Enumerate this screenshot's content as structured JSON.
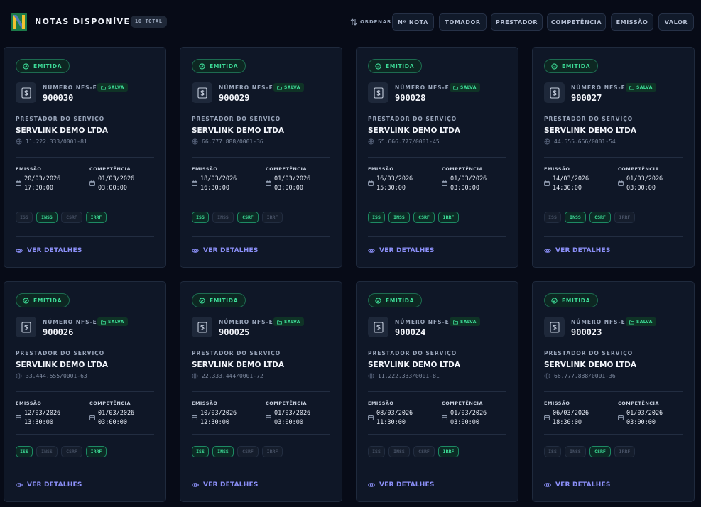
{
  "header": {
    "title": "NOTAS DISPONÍVEIS",
    "total_badge": "10 TOTAL",
    "order_label": "ORDENAR",
    "sort_buttons": [
      "Nº NOTA",
      "TOMADOR",
      "PRESTADOR",
      "COMPETÊNCIA",
      "EMISSÃO",
      "VALOR"
    ]
  },
  "labels": {
    "status": "EMITIDA",
    "numero": "NÚMERO NFS-E",
    "salva": "SALVA",
    "prestador": "PRESTADOR DO SERVIÇO",
    "emissao": "EMISSÃO",
    "competencia": "COMPETÊNCIA",
    "ver_detalhes": "VER DETALHES"
  },
  "tax_names": [
    "ISS",
    "INSS",
    "CSRF",
    "IRRF"
  ],
  "cards": [
    {
      "numero": "900030",
      "prestador": "SERVLINK DEMO LTDA",
      "cnpj": "11.222.333/0001-81",
      "emissao_date": "20/03/2026",
      "emissao_time": "17:30:00",
      "competencia_date": "01/03/2026",
      "competencia_time": "03:00:00",
      "taxes": [
        false,
        true,
        false,
        true
      ]
    },
    {
      "numero": "900029",
      "prestador": "SERVLINK DEMO LTDA",
      "cnpj": "66.777.888/0001-36",
      "emissao_date": "18/03/2026",
      "emissao_time": "16:30:00",
      "competencia_date": "01/03/2026",
      "competencia_time": "03:00:00",
      "taxes": [
        true,
        false,
        true,
        false
      ]
    },
    {
      "numero": "900028",
      "prestador": "SERVLINK DEMO LTDA",
      "cnpj": "55.666.777/0001-45",
      "emissao_date": "16/03/2026",
      "emissao_time": "15:30:00",
      "competencia_date": "01/03/2026",
      "competencia_time": "03:00:00",
      "taxes": [
        true,
        true,
        true,
        true
      ]
    },
    {
      "numero": "900027",
      "prestador": "SERVLINK DEMO LTDA",
      "cnpj": "44.555.666/0001-54",
      "emissao_date": "14/03/2026",
      "emissao_time": "14:30:00",
      "competencia_date": "01/03/2026",
      "competencia_time": "03:00:00",
      "taxes": [
        false,
        true,
        true,
        false
      ]
    },
    {
      "numero": "900026",
      "prestador": "SERVLINK DEMO LTDA",
      "cnpj": "33.444.555/0001-63",
      "emissao_date": "12/03/2026",
      "emissao_time": "13:30:00",
      "competencia_date": "01/03/2026",
      "competencia_time": "03:00:00",
      "taxes": [
        true,
        false,
        false,
        true
      ]
    },
    {
      "numero": "900025",
      "prestador": "SERVLINK DEMO LTDA",
      "cnpj": "22.333.444/0001-72",
      "emissao_date": "10/03/2026",
      "emissao_time": "12:30:00",
      "competencia_date": "01/03/2026",
      "competencia_time": "03:00:00",
      "taxes": [
        true,
        true,
        false,
        false
      ]
    },
    {
      "numero": "900024",
      "prestador": "SERVLINK DEMO LTDA",
      "cnpj": "11.222.333/0001-81",
      "emissao_date": "08/03/2026",
      "emissao_time": "11:30:00",
      "competencia_date": "01/03/2026",
      "competencia_time": "03:00:00",
      "taxes": [
        false,
        false,
        false,
        true
      ]
    },
    {
      "numero": "900023",
      "prestador": "SERVLINK DEMO LTDA",
      "cnpj": "66.777.888/0001-36",
      "emissao_date": "06/03/2026",
      "emissao_time": "18:30:00",
      "competencia_date": "01/03/2026",
      "competencia_time": "03:00:00",
      "taxes": [
        false,
        false,
        true,
        false
      ]
    }
  ],
  "colors": {
    "background": "#070b17",
    "card": "#0f1727",
    "accent_green": "#3ddc97",
    "link": "#8b8ff7"
  }
}
